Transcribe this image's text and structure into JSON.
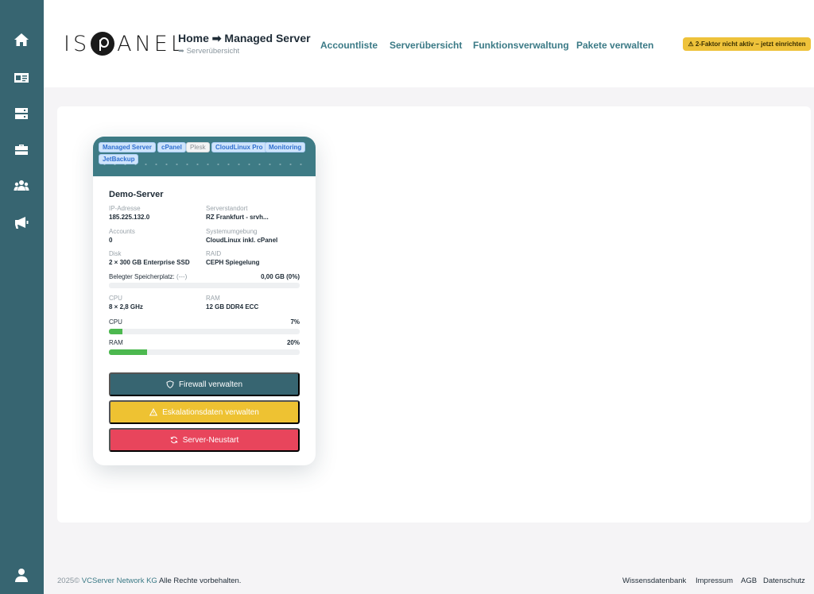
{
  "sidebar": {
    "items": [
      {
        "icon": "home-icon"
      },
      {
        "icon": "id-card-icon"
      },
      {
        "icon": "server-icon"
      },
      {
        "icon": "toolbox-icon"
      },
      {
        "icon": "users-icon"
      },
      {
        "icon": "megaphone-icon"
      }
    ],
    "bottom_icon": "user-icon"
  },
  "header": {
    "logo": "ISPANEL",
    "breadcrumb": "Home ➡ Managed Server",
    "subtitle": "➥ Serverübersicht",
    "nav": [
      "Accountliste",
      "Serverübersicht",
      "Funktionsverwaltung",
      "Pakete verwalten"
    ],
    "twofa_badge": "⚠ 2-Faktor nicht aktiv – jetzt einrichten"
  },
  "server": {
    "tags": [
      "Managed Server",
      "cPanel",
      "Plesk",
      "CloudLinux Pro",
      "Monitoring",
      "JetBackup"
    ],
    "name": "Demo-Server",
    "ip_label": "IP-Adresse",
    "ip": "185.225.132.0",
    "location_label": "Serverstandort",
    "location": "RZ Frankfurt - srvh...",
    "accounts_label": "Accounts",
    "accounts": "0",
    "env_label": "Systemumgebung",
    "env": "CloudLinux inkl. cPanel",
    "disk_label": "Disk",
    "disk": "2 × 300 GB Enterprise SSD",
    "raid_label": "RAID",
    "raid": "CEPH Spiegelung",
    "storage_label": "Belegter Speicherplatz:",
    "storage_extra": "(---)",
    "storage_value": "0,00 GB (0%)",
    "storage_fraction": 0.0,
    "cpu_label": "CPU",
    "cpu": "8 × 2,8 GHz",
    "ram_label": "RAM",
    "ram": "12 GB DDR4 ECC",
    "cpu_usage_label": "CPU",
    "cpu_usage": "7%",
    "cpu_fraction": 0.07,
    "ram_usage_label": "RAM",
    "ram_usage": "20%",
    "ram_fraction": 0.2,
    "buttons": {
      "firewall": "Firewall verwalten",
      "escalation": "Eskalationsdaten verwalten",
      "restart": "Server-Neustart"
    }
  },
  "footer": {
    "year": "2025©",
    "company": "VCServer Network KG",
    "rights": "Alle Rechte vorbehalten.",
    "links": [
      "Wissensdatenbank",
      "Impressum",
      "AGB",
      "Datenschutz"
    ]
  },
  "colors": {
    "sidebar": "#376571",
    "accent_link": "#3b7a86",
    "warning": "#eec232",
    "danger": "#e8455c",
    "success": "#4cb84f"
  }
}
